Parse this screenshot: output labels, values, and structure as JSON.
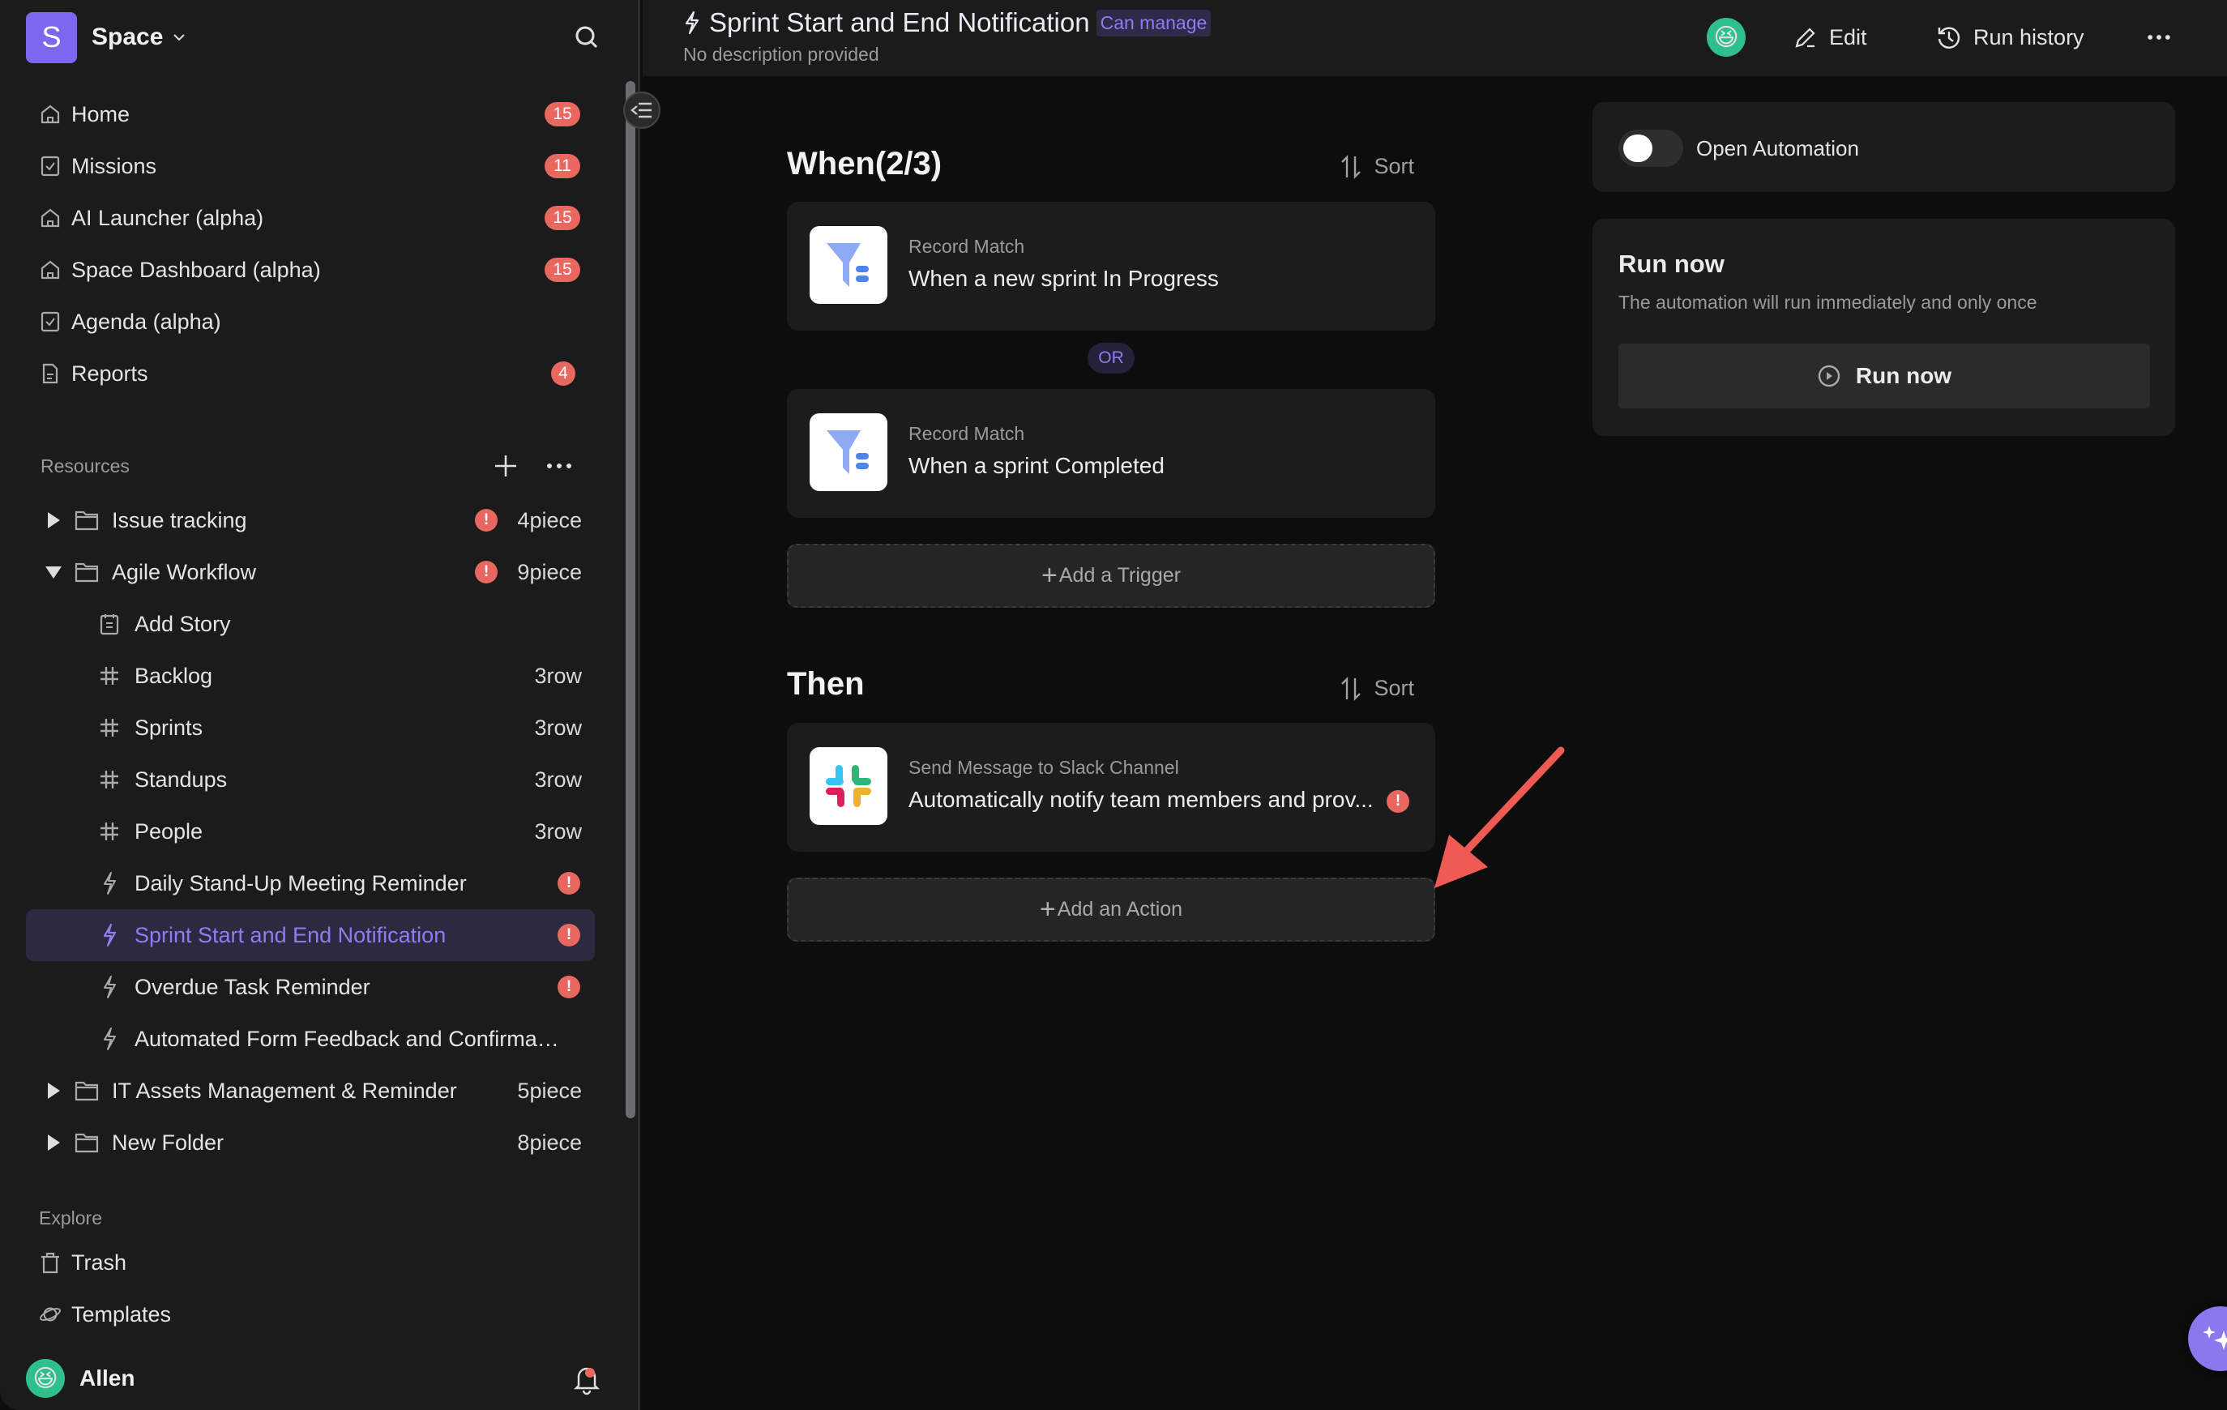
{
  "sidebar": {
    "space_initial": "S",
    "space_name": "Space",
    "nav": [
      {
        "label": "Home",
        "icon": "home-icon",
        "badge": "15"
      },
      {
        "label": "Missions",
        "icon": "checkbox-icon",
        "badge": "11"
      },
      {
        "label": "AI Launcher (alpha)",
        "icon": "home-icon",
        "badge": "15"
      },
      {
        "label": "Space Dashboard (alpha)",
        "icon": "home-icon",
        "badge": "15"
      },
      {
        "label": "Agenda (alpha)",
        "icon": "checkbox-icon",
        "badge": ""
      },
      {
        "label": "Reports",
        "icon": "document-icon",
        "badge": "4"
      }
    ],
    "resources_label": "Resources",
    "tree": [
      {
        "label": "Issue tracking",
        "type": "folder",
        "expanded": false,
        "count": "4piece",
        "warning": true
      },
      {
        "label": "Agile Workflow",
        "type": "folder",
        "expanded": true,
        "count": "9piece",
        "warning": true
      },
      {
        "label": "Add Story",
        "type": "form",
        "count": "",
        "warning": false
      },
      {
        "label": "Backlog",
        "type": "datasheet",
        "count": "3row",
        "warning": false
      },
      {
        "label": "Sprints",
        "type": "datasheet",
        "count": "3row",
        "warning": false
      },
      {
        "label": "Standups",
        "type": "datasheet",
        "count": "3row",
        "warning": false
      },
      {
        "label": "People",
        "type": "datasheet",
        "count": "3row",
        "warning": false
      },
      {
        "label": "Daily Stand-Up Meeting Reminder",
        "type": "automation",
        "count": "",
        "warning": true
      },
      {
        "label": "Sprint Start and End Notification",
        "type": "automation",
        "count": "",
        "warning": true,
        "selected": true
      },
      {
        "label": "Overdue Task Reminder",
        "type": "automation",
        "count": "",
        "warning": true
      },
      {
        "label": "Automated Form Feedback and Confirma…",
        "type": "automation",
        "count": "",
        "warning": false
      },
      {
        "label": "IT Assets Management & Reminder",
        "type": "folder",
        "expanded": false,
        "count": "5piece",
        "warning": false
      },
      {
        "label": "New Folder",
        "type": "folder",
        "expanded": false,
        "count": "8piece",
        "warning": false
      }
    ],
    "explore_label": "Explore",
    "explore": [
      {
        "label": "Trash",
        "icon": "trash-icon"
      },
      {
        "label": "Templates",
        "icon": "planet-icon"
      }
    ],
    "user_name": "Allen",
    "user_avatar": "😆"
  },
  "header": {
    "title": "Sprint Start and End Notification",
    "permission": "Can manage",
    "description": "No description provided",
    "avatar": "😆",
    "edit_label": "Edit",
    "run_history_label": "Run history",
    "more": "···"
  },
  "when": {
    "title": "When(2/3)",
    "sort_label": "Sort",
    "triggers": [
      {
        "kind": "Record Match",
        "text": "When a new sprint In Progress"
      },
      {
        "kind": "Record Match",
        "text": "When a sprint Completed"
      }
    ],
    "or_label": "OR",
    "add_label": "Add a Trigger"
  },
  "then": {
    "title": "Then",
    "sort_label": "Sort",
    "actions": [
      {
        "kind": "Send Message to Slack Channel",
        "text": "Automatically notify team members and prov...",
        "warning": true
      }
    ],
    "add_label": "Add an Action"
  },
  "right_panel": {
    "toggle_label": "Open Automation",
    "toggle_on": false,
    "run_title": "Run now",
    "run_desc": "The automation will run immediately and only once",
    "run_button": "Run now"
  },
  "colors": {
    "accent": "#8f7cf0",
    "warning": "#e8675e",
    "space_logo": "#7b68ee"
  }
}
